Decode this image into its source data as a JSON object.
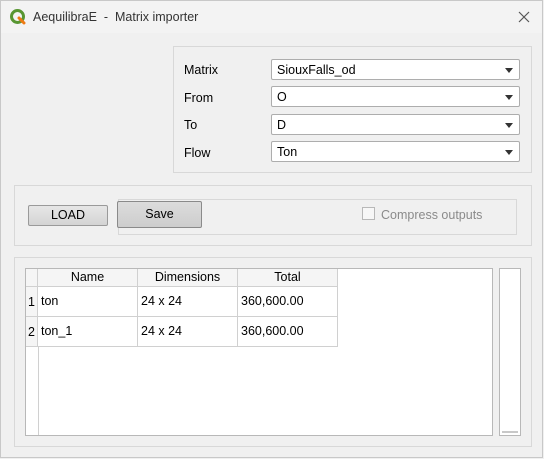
{
  "window": {
    "title": "AequilibraE  -  Matrix importer",
    "accent": "#4a9a3a"
  },
  "fields": [
    {
      "label": "Matrix",
      "value": "SiouxFalls_od"
    },
    {
      "label": "From",
      "value": "O"
    },
    {
      "label": "To",
      "value": "D"
    },
    {
      "label": "Flow",
      "value": "Ton"
    }
  ],
  "buttons": {
    "load_label": "LOAD",
    "save_label": "Save"
  },
  "compress": {
    "label": "Compress outputs",
    "checked": false
  },
  "table": {
    "columns": [
      "Name",
      "Dimensions",
      "Total"
    ],
    "rows": [
      {
        "index": "1",
        "name": "ton",
        "dimensions": "24 x 24",
        "total": "360,600.00"
      },
      {
        "index": "2",
        "name": "ton_1",
        "dimensions": "24 x 24",
        "total": "360,600.00"
      }
    ]
  }
}
